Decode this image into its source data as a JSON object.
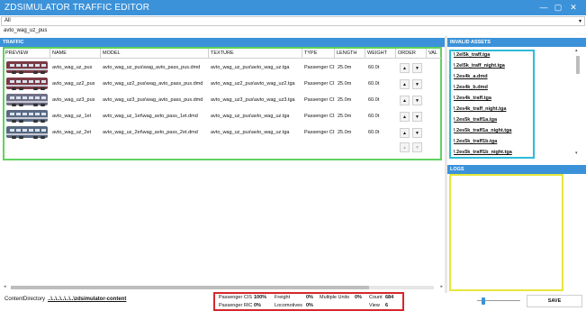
{
  "window": {
    "title": "ZDSIMULATOR TRAFFIC EDITOR",
    "controls": [
      "—",
      "▢",
      "✕"
    ],
    "title_bar_color": "#3b92d9"
  },
  "filter": {
    "value": "All",
    "arrow": "▾"
  },
  "selected_name": "avto_wag_uz_pus",
  "traffic": {
    "header": "TRAFFIC",
    "columns": [
      "PREVIEW",
      "NAME",
      "MODEL",
      "TEXTURE",
      "TYPE",
      "LENGTH",
      "WEIGHT",
      "ORDER",
      "VAL"
    ],
    "rows": [
      {
        "name": "avto_wag_uz_pus",
        "model": "avto_wag_uz_pus\\wag_avto_pass_pus.dmd",
        "texture": "avto_wag_uz_pus\\avto_wag_uz.tga",
        "type": "Passenger CIS",
        "length": "25.0m",
        "weight": "60.0t",
        "color": "#7a3b44"
      },
      {
        "name": "avto_wag_uz2_pus",
        "model": "avto_wag_uz2_pus\\wag_avto_pass_pus.dmd",
        "texture": "avto_wag_uz2_pus\\avto_wag_uz2.tga",
        "type": "Passenger CIS",
        "length": "25.0m",
        "weight": "60.0t",
        "color": "#7d3a46"
      },
      {
        "name": "avto_wag_uz3_pus",
        "model": "avto_wag_uz3_pus\\wag_avto_pass_pus.dmd",
        "texture": "avto_wag_uz3_pus\\avto_wag_uz3.tga",
        "type": "Passenger CIS",
        "length": "25.0m",
        "weight": "60.0t",
        "color": "#6f6f86"
      },
      {
        "name": "avto_wag_uz_1et",
        "model": "avto_wag_uz_1et\\wag_avto_pass_1et.dmd",
        "texture": "avto_wag_uz_pus\\avto_wag_uz.tga",
        "type": "Passenger CIS",
        "length": "25.0m",
        "weight": "60.0t",
        "color": "#5a6a84"
      },
      {
        "name": "avto_wag_uz_2et",
        "model": "avto_wag_uz_2et\\wag_avto_pass_2et.dmd",
        "texture": "avto_wag_uz_pus\\avto_wag_uz.tga",
        "type": "Passenger CIS",
        "length": "25.0m",
        "weight": "60.0t",
        "color": "#566880"
      }
    ],
    "order_up": "▲",
    "order_down": "▼"
  },
  "invalid_assets": {
    "header": "INVALID ASSETS",
    "items": [
      "\\ 2el5k_traff.tga",
      "\\ 2el5k_traff_night.tga",
      "\\ 2es4k_a.dmd",
      "\\ 2es4k_b.dmd",
      "\\ 2es4k_traff.tga",
      "\\ 2es4k_traff_night.tga",
      "\\ 2es5k_traff1a.tga",
      "\\ 2es5k_traff1a_night.tga",
      "\\ 2es5k_traff1b.tga",
      "\\ 2es5k_traff1b_night.tga"
    ]
  },
  "logs": {
    "header": "LOGS"
  },
  "status": {
    "content_directory_label": "ContentDirectory",
    "content_directory_path": "..\\..\\..\\..\\..\\..\\zdsimulator-content",
    "passenger_cis_label": "Passenger CIS",
    "passenger_cis_value": "100%",
    "passenger_ric_label": "Passenger RIC",
    "passenger_ric_value": "0%",
    "freight_label": "Freight",
    "freight_value": "0%",
    "locomotives_label": "Locomotives",
    "locomotives_value": "0%",
    "multiple_units_label": "Multiple Units",
    "multiple_units_value": "0%",
    "count_label": "Count",
    "count_value": "684",
    "view_label": "View",
    "view_value": "6"
  },
  "save_label": "SAVE"
}
